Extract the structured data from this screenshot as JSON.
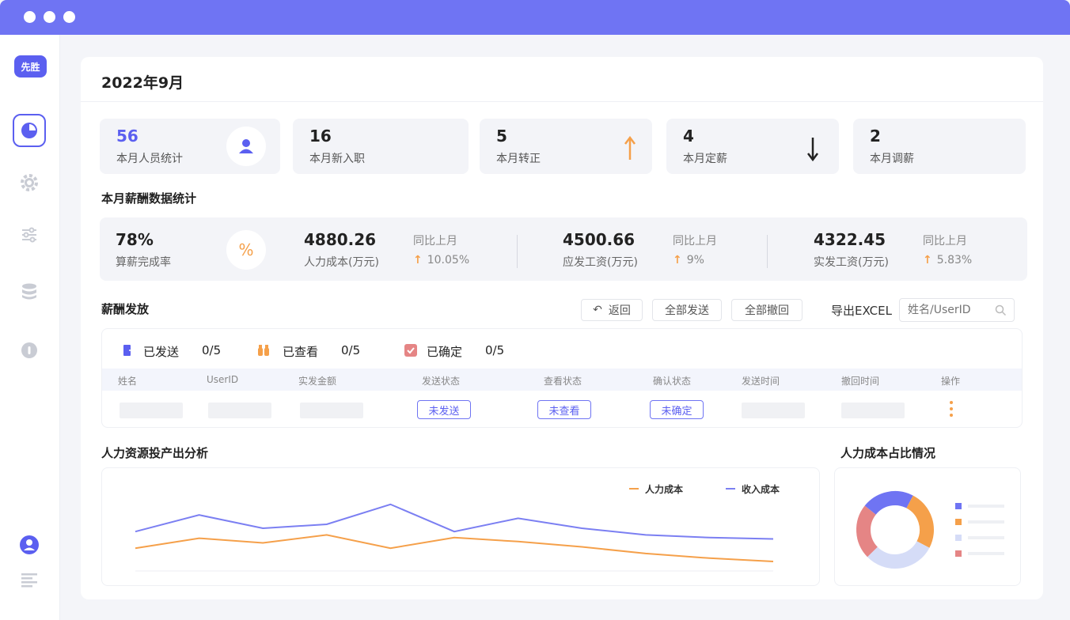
{
  "app": {
    "logo_text": "先胜"
  },
  "header": {
    "title": "2022年9月"
  },
  "stats": [
    {
      "value": "56",
      "label": "本月人员统计",
      "icon": "user-icon"
    },
    {
      "value": "16",
      "label": "本月新入职"
    },
    {
      "value": "5",
      "label": "本月转正",
      "icon": "arrow-up-icon"
    },
    {
      "value": "4",
      "label": "本月定薪",
      "icon": "arrow-down-icon"
    },
    {
      "value": "2",
      "label": "本月调薪"
    }
  ],
  "salary_section": {
    "title": "本月薪酬数据统计",
    "completion": {
      "value": "78%",
      "label": "算薪完成率",
      "icon_text": "%"
    },
    "metrics": [
      {
        "value": "4880.26",
        "label": "人力成本(万元)",
        "compare_label": "同比上月",
        "change": "10.05%"
      },
      {
        "value": "4500.66",
        "label": "应发工资(万元)",
        "compare_label": "同比上月",
        "change": "9%"
      },
      {
        "value": "4322.45",
        "label": "实发工资(万元)",
        "compare_label": "同比上月",
        "change": "5.83%"
      }
    ]
  },
  "distribution": {
    "title": "薪酬发放",
    "actions": {
      "back": "返回",
      "send_all": "全部发送",
      "revoke_all": "全部撤回",
      "export": "导出EXCEL"
    },
    "search_placeholder": "姓名/UserID",
    "status": [
      {
        "label": "已发送",
        "count": "0/5"
      },
      {
        "label": "已查看",
        "count": "0/5"
      },
      {
        "label": "已确定",
        "count": "0/5"
      }
    ],
    "columns": [
      "姓名",
      "UserID",
      "实发金额",
      "发送状态",
      "查看状态",
      "确认状态",
      "发送时间",
      "撤回时间",
      "操作"
    ],
    "row": {
      "send_status": "未发送",
      "view_status": "未查看",
      "confirm_status": "未确定"
    }
  },
  "line_chart": {
    "title": "人力资源投产出分析",
    "chart_data": {
      "type": "line",
      "x": [
        0,
        1,
        2,
        3,
        4,
        5,
        6,
        7,
        8,
        9,
        10
      ],
      "series": [
        {
          "name": "人力成本",
          "color": "#f5a04a",
          "values": [
            20,
            35,
            28,
            40,
            20,
            36,
            30,
            22,
            12,
            5,
            0
          ]
        },
        {
          "name": "收入成本",
          "color": "#7b7ff2",
          "values": [
            45,
            70,
            50,
            56,
            86,
            45,
            65,
            50,
            40,
            36,
            34
          ]
        }
      ],
      "ylim": [
        0,
        100
      ]
    }
  },
  "donut_chart": {
    "title": "人力成本占比情况",
    "chart_data": {
      "type": "pie",
      "values": [
        22,
        25,
        30,
        23
      ],
      "colors": [
        "#6f74f3",
        "#f5a04a",
        "#d5dcf7",
        "#e58585"
      ]
    }
  }
}
